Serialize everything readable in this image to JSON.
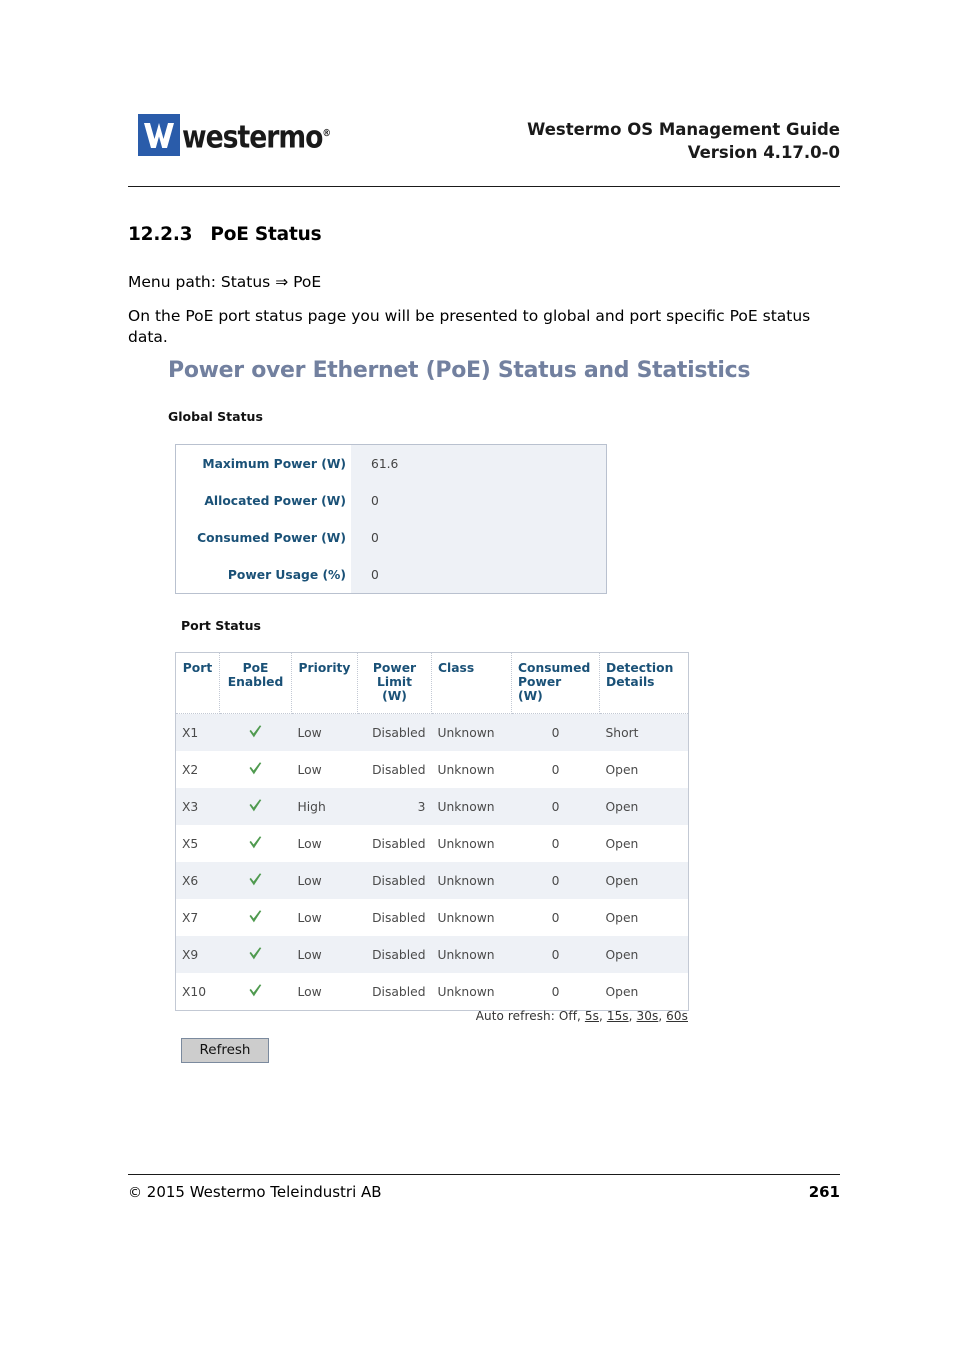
{
  "header": {
    "logo_text": "westermo",
    "logo_registered": "®",
    "doc_title": "Westermo OS Management Guide",
    "doc_version": "Version 4.17.0-0"
  },
  "section": {
    "number": "12.2.3",
    "title": "PoE Status",
    "menu_path": "Menu path: Status ⇒ PoE",
    "intro": "On the PoE port status page you will be presented to global and port specific PoE status data."
  },
  "screenshot": {
    "title": "Power over Ethernet (PoE) Status and Statistics",
    "global_status_label": "Global Status",
    "port_status_label": "Port Status",
    "global_status": [
      {
        "label": "Maximum Power (W)",
        "value": "61.6"
      },
      {
        "label": "Allocated Power (W)",
        "value": "0"
      },
      {
        "label": "Consumed Power (W)",
        "value": "0"
      },
      {
        "label": "Power Usage (%)",
        "value": "0"
      }
    ],
    "port_table": {
      "columns": [
        "Port",
        "PoE Enabled",
        "Priority",
        "Power Limit (W)",
        "Class",
        "Consumed Power (W)",
        "Detection Details"
      ],
      "columns_wrapped": [
        [
          "Port"
        ],
        [
          "PoE",
          "Enabled"
        ],
        [
          "Priority"
        ],
        [
          "Power",
          "Limit",
          "(W)"
        ],
        [
          "Class"
        ],
        [
          "Consumed",
          "Power",
          "(W)"
        ],
        [
          "Detection",
          "Details"
        ]
      ],
      "rows": [
        {
          "port": "X1",
          "poe_enabled": "check-icon",
          "priority": "Low",
          "power_limit": "Disabled",
          "class": "Unknown",
          "consumed_power": "0",
          "detection_details": "Short"
        },
        {
          "port": "X2",
          "poe_enabled": "check-icon",
          "priority": "Low",
          "power_limit": "Disabled",
          "class": "Unknown",
          "consumed_power": "0",
          "detection_details": "Open"
        },
        {
          "port": "X3",
          "poe_enabled": "check-icon",
          "priority": "High",
          "power_limit": "3",
          "class": "Unknown",
          "consumed_power": "0",
          "detection_details": "Open"
        },
        {
          "port": "X5",
          "poe_enabled": "check-icon",
          "priority": "Low",
          "power_limit": "Disabled",
          "class": "Unknown",
          "consumed_power": "0",
          "detection_details": "Open"
        },
        {
          "port": "X6",
          "poe_enabled": "check-icon",
          "priority": "Low",
          "power_limit": "Disabled",
          "class": "Unknown",
          "consumed_power": "0",
          "detection_details": "Open"
        },
        {
          "port": "X7",
          "poe_enabled": "check-icon",
          "priority": "Low",
          "power_limit": "Disabled",
          "class": "Unknown",
          "consumed_power": "0",
          "detection_details": "Open"
        },
        {
          "port": "X9",
          "poe_enabled": "check-icon",
          "priority": "Low",
          "power_limit": "Disabled",
          "class": "Unknown",
          "consumed_power": "0",
          "detection_details": "Open"
        },
        {
          "port": "X10",
          "poe_enabled": "check-icon",
          "priority": "Low",
          "power_limit": "Disabled",
          "class": "Unknown",
          "consumed_power": "0",
          "detection_details": "Open"
        }
      ]
    },
    "auto_refresh": {
      "prefix": "Auto refresh:",
      "off": "Off",
      "options": [
        "5s",
        "15s",
        "30s",
        "60s"
      ]
    },
    "refresh_button": "Refresh"
  },
  "footer": {
    "copyright_symbol": "©",
    "copyright": "2015 Westermo Teleindustri AB",
    "page_number": "261"
  },
  "colors": {
    "logo_blue": "#2a5caa",
    "screenshot_title": "#72809f",
    "table_header_text": "#1a5177",
    "row_alt_bg": "#eef1f6",
    "check_green": "#4f9a4f"
  }
}
